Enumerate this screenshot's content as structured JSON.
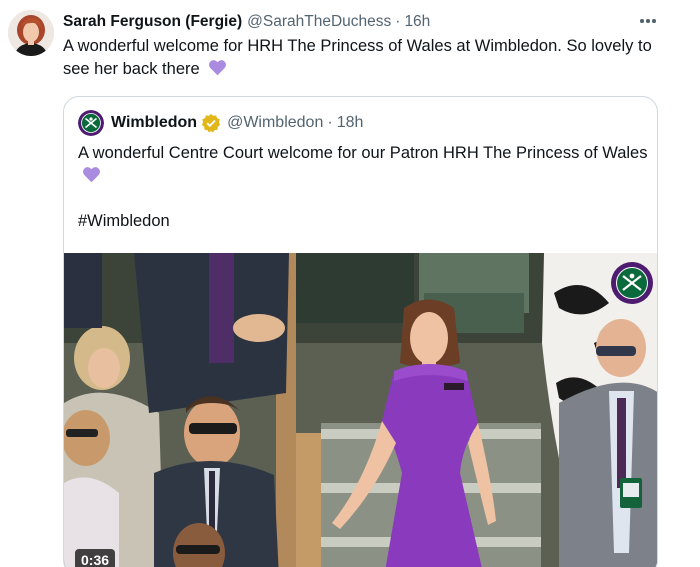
{
  "post": {
    "author": {
      "display_name": "Sarah Ferguson (Fergie)",
      "handle": "@SarahTheDuchess",
      "avatar_icon": "profile-photo"
    },
    "separator": "·",
    "time": "16h",
    "text": "A wonderful welcome for HRH The Princess of Wales at Wimbledon. So lovely to see her back there",
    "emoji": "purple-heart",
    "more_icon": "more-horizontal-icon"
  },
  "quoted_post": {
    "author": {
      "display_name": "Wimbledon",
      "handle": "@Wimbledon",
      "verified": "gold-verified-badge",
      "avatar_icon": "wimbledon-logo"
    },
    "separator": "·",
    "time": "18h",
    "text": "A wonderful Centre Court welcome for our Patron HRH The Princess of Wales",
    "hashtag": "#Wimbledon",
    "media": {
      "type": "video",
      "duration": "0:36",
      "watermark_icon": "wimbledon-championships-logo"
    }
  },
  "colors": {
    "text_primary": "#0f1419",
    "text_secondary": "#536471",
    "border": "#cfd9de",
    "heart": "#a98be0",
    "dress": "#8a3bbd",
    "wimbledon_purple": "#4d1b6f",
    "wimbledon_green": "#0a6a3c",
    "verified_gold": "#e2b719"
  }
}
